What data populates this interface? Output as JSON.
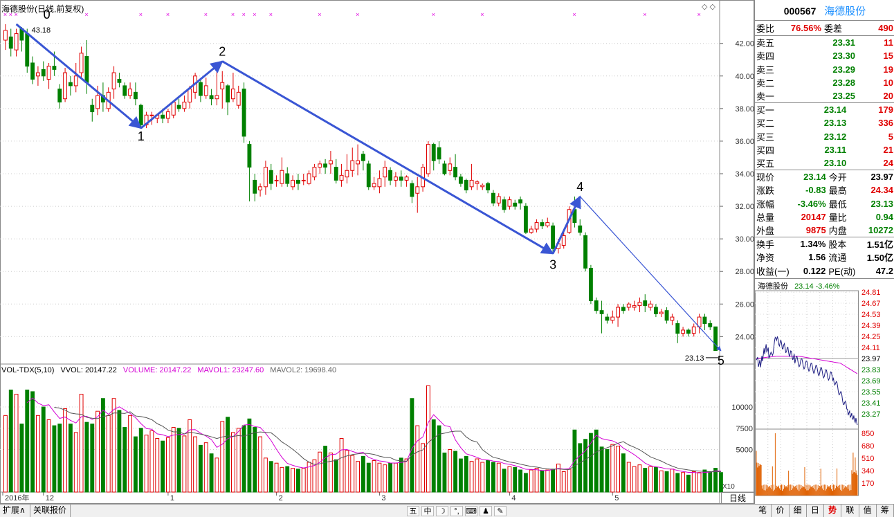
{
  "window": {
    "chart_title": "海德股份(日线,前复权)",
    "daily_tab_label": "日线",
    "x10_label": "X10"
  },
  "volume_header": {
    "indicator": "VOL-TDX(5,10)",
    "vvol": "VVOL: 20147.22",
    "volume": "VOLUME: 20147.22",
    "mavol1": "MAVOL1: 23247.60",
    "mavol2": "MAVOL2: 19698.40"
  },
  "annotations": {
    "wave_labels": [
      "0",
      "1",
      "2",
      "3",
      "4",
      "5"
    ],
    "high_marker": "43.18",
    "low_marker": "23.13"
  },
  "bottom_bar": {
    "expand_label": "扩展∧",
    "related_quote_label": "关联报价",
    "tools": [
      "五",
      "中",
      "☽",
      "°,",
      "⌨",
      "♟",
      "✎"
    ]
  },
  "quote_panel": {
    "code": "000567",
    "name": "海德股份",
    "committee": {
      "ratio_label": "委比",
      "ratio": "76.56%",
      "diff_label": "委差",
      "diff": "490"
    },
    "asks": [
      {
        "label": "卖五",
        "price": "23.31",
        "vol": "11"
      },
      {
        "label": "卖四",
        "price": "23.30",
        "vol": "15"
      },
      {
        "label": "卖三",
        "price": "23.29",
        "vol": "19"
      },
      {
        "label": "卖二",
        "price": "23.28",
        "vol": "10"
      },
      {
        "label": "卖一",
        "price": "23.25",
        "vol": "20"
      }
    ],
    "bids": [
      {
        "label": "买一",
        "price": "23.14",
        "vol": "179"
      },
      {
        "label": "买二",
        "price": "23.13",
        "vol": "336"
      },
      {
        "label": "买三",
        "price": "23.12",
        "vol": "5"
      },
      {
        "label": "买四",
        "price": "23.11",
        "vol": "21"
      },
      {
        "label": "买五",
        "price": "23.10",
        "vol": "24"
      }
    ],
    "stats": [
      {
        "l1": "现价",
        "v1": "23.14",
        "c1": "green",
        "l2": "今开",
        "v2": "23.97",
        "c2": "blk"
      },
      {
        "l1": "涨跌",
        "v1": "-0.83",
        "c1": "green",
        "l2": "最高",
        "v2": "24.34",
        "c2": "red"
      },
      {
        "l1": "涨幅",
        "v1": "-3.46%",
        "c1": "green",
        "l2": "最低",
        "v2": "23.13",
        "c2": "green"
      },
      {
        "l1": "总量",
        "v1": "20147",
        "c1": "red",
        "l2": "量比",
        "v2": "0.94",
        "c2": "green"
      },
      {
        "l1": "外盘",
        "v1": "9875",
        "c1": "red",
        "l2": "内盘",
        "v2": "10272",
        "c2": "green"
      }
    ],
    "fundamentals": [
      {
        "l1": "换手",
        "v1": "1.34%",
        "l2": "股本",
        "v2": "1.51亿"
      },
      {
        "l1": "净资",
        "v1": "1.56",
        "l2": "流通",
        "v2": "1.50亿"
      },
      {
        "l1": "收益(一)",
        "v1": "0.122",
        "l2": "PE(动)",
        "v2": "47.2"
      }
    ]
  },
  "intraday": {
    "name": "海德股份",
    "price_change": "23.14 -3.46%",
    "price_ticks": [
      "24.81",
      "24.67",
      "24.53",
      "24.39",
      "24.25",
      "24.11",
      "23.97",
      "23.83",
      "23.69",
      "23.55",
      "23.41",
      "23.27"
    ],
    "volume_ticks": [
      "850",
      "680",
      "510",
      "340",
      "170"
    ],
    "price_range": [
      23.13,
      24.81
    ],
    "prev_close": 23.97
  },
  "right_tabs": [
    "笔",
    "价",
    "细",
    "日",
    "势",
    "联",
    "值",
    "筹"
  ],
  "right_tab_active": "势",
  "chart_data": {
    "type": "candlestick",
    "title": "海德股份(日线,前复权)",
    "price_axis": {
      "ticks": [
        24,
        26,
        28,
        30,
        32,
        34,
        36,
        38,
        40,
        42
      ],
      "ylim": [
        22.4,
        43.9
      ]
    },
    "volume_axis": {
      "ticks": [
        5000,
        7500,
        10000
      ],
      "ylim": [
        0,
        13500
      ]
    },
    "date_labels": [
      {
        "label": "2016年",
        "index": 0
      },
      {
        "label": "12",
        "index": 7
      },
      {
        "label": "1",
        "index": 30
      },
      {
        "label": "2",
        "index": 50
      },
      {
        "label": "3",
        "index": 69
      },
      {
        "label": "4",
        "index": 93
      },
      {
        "label": "5",
        "index": 112
      }
    ],
    "candles": [
      [
        42.2,
        42.8,
        41.6,
        43.18
      ],
      [
        42.4,
        41.7,
        41.2,
        42.9
      ],
      [
        41.6,
        42.6,
        41.2,
        42.9
      ],
      [
        42.9,
        42.2,
        41.5,
        43.0
      ],
      [
        42.6,
        40.6,
        40.2,
        42.9
      ],
      [
        40.8,
        39.8,
        39.5,
        41.2
      ],
      [
        40.0,
        40.2,
        39.4,
        40.6
      ],
      [
        40.4,
        40.0,
        39.7,
        40.9
      ],
      [
        39.8,
        40.6,
        39.2,
        40.8
      ],
      [
        40.6,
        40.4,
        40.0,
        41.5
      ],
      [
        39.2,
        38.4,
        38.0,
        39.5
      ],
      [
        38.6,
        40.2,
        38.4,
        40.5
      ],
      [
        39.6,
        39.4,
        38.8,
        40.0
      ],
      [
        39.4,
        40.0,
        39.0,
        40.8
      ],
      [
        40.2,
        41.4,
        39.8,
        41.8
      ],
      [
        41.2,
        39.6,
        38.9,
        42.2
      ],
      [
        38.2,
        37.8,
        37.2,
        38.6
      ],
      [
        38.0,
        38.8,
        37.6,
        39.4
      ],
      [
        38.8,
        38.4,
        37.8,
        39.6
      ],
      [
        38.0,
        39.0,
        37.8,
        39.3
      ],
      [
        39.2,
        40.2,
        38.6,
        40.6
      ],
      [
        39.8,
        39.6,
        39.3,
        40.2
      ],
      [
        39.4,
        38.8,
        38.6,
        39.6
      ],
      [
        38.8,
        39.2,
        38.6,
        39.6
      ],
      [
        39.0,
        38.6,
        38.2,
        39.6
      ],
      [
        38.2,
        37.0,
        36.8,
        38.3
      ],
      [
        37.0,
        37.6,
        36.8,
        37.8
      ],
      [
        37.6,
        37.6,
        37.0,
        37.8
      ],
      [
        37.4,
        37.6,
        37.1,
        37.7
      ],
      [
        37.6,
        37.4,
        37.1,
        38.0
      ],
      [
        37.4,
        37.8,
        37.1,
        38.0
      ],
      [
        37.6,
        38.4,
        37.4,
        38.4
      ],
      [
        38.2,
        38.0,
        37.8,
        38.6
      ],
      [
        38.0,
        38.4,
        37.8,
        38.8
      ],
      [
        38.4,
        39.2,
        38.0,
        39.4
      ],
      [
        39.0,
        40.0,
        38.6,
        40.2
      ],
      [
        39.6,
        38.8,
        38.4,
        39.8
      ],
      [
        38.8,
        39.4,
        38.6,
        39.9
      ],
      [
        38.8,
        38.6,
        38.2,
        39.2
      ],
      [
        38.6,
        38.8,
        38.2,
        40.5
      ],
      [
        39.2,
        39.6,
        38.0,
        40.3
      ],
      [
        39.4,
        38.4,
        37.6,
        39.5
      ],
      [
        38.6,
        39.2,
        38.4,
        40.2
      ],
      [
        38.2,
        39.0,
        38.0,
        39.4
      ],
      [
        39.2,
        36.3,
        35.9,
        39.6
      ],
      [
        35.8,
        34.4,
        32.3,
        36.0
      ],
      [
        33.6,
        32.8,
        32.3,
        34.0
      ],
      [
        33.0,
        33.2,
        32.6,
        33.4
      ],
      [
        33.2,
        34.4,
        32.7,
        34.8
      ],
      [
        34.2,
        33.4,
        33.0,
        34.6
      ],
      [
        33.6,
        33.6,
        33.2,
        33.9
      ],
      [
        33.4,
        34.2,
        33.2,
        35.0
      ],
      [
        34.0,
        33.4,
        33.2,
        34.4
      ],
      [
        33.2,
        33.6,
        33.0,
        33.9
      ],
      [
        33.6,
        33.4,
        33.0,
        34.0
      ],
      [
        33.6,
        33.6,
        33.3,
        34.0
      ],
      [
        33.4,
        34.0,
        33.3,
        34.2
      ],
      [
        33.8,
        34.4,
        33.6,
        34.6
      ],
      [
        34.4,
        34.6,
        34.0,
        34.8
      ],
      [
        34.6,
        34.4,
        34.0,
        34.9
      ],
      [
        34.6,
        34.8,
        34.0,
        35.4
      ],
      [
        34.4,
        33.6,
        33.4,
        34.9
      ],
      [
        33.6,
        33.9,
        33.2,
        34.6
      ],
      [
        33.8,
        34.2,
        33.4,
        35.2
      ],
      [
        34.2,
        34.8,
        33.8,
        35.6
      ],
      [
        34.6,
        34.8,
        33.9,
        35.8
      ],
      [
        35.2,
        34.8,
        34.2,
        35.4
      ],
      [
        34.6,
        33.2,
        33.0,
        34.8
      ],
      [
        33.2,
        33.4,
        33.0,
        33.8
      ],
      [
        33.2,
        33.7,
        32.8,
        34.2
      ],
      [
        33.8,
        34.4,
        33.2,
        34.8
      ],
      [
        34.2,
        33.6,
        33.3,
        34.4
      ],
      [
        33.6,
        33.8,
        33.2,
        34.1
      ],
      [
        33.8,
        33.6,
        33.2,
        34.2
      ],
      [
        33.6,
        33.8,
        33.2,
        33.9
      ],
      [
        33.4,
        32.6,
        32.2,
        33.6
      ],
      [
        32.8,
        33.2,
        31.6,
        33.8
      ],
      [
        33.2,
        34.4,
        32.9,
        34.6
      ],
      [
        34.0,
        35.8,
        33.8,
        36.0
      ],
      [
        35.8,
        34.8,
        34.2,
        35.9
      ],
      [
        35.6,
        34.9,
        34.6,
        36.0
      ],
      [
        34.6,
        34.0,
        33.9,
        34.8
      ],
      [
        34.2,
        34.6,
        33.9,
        35.0
      ],
      [
        34.4,
        33.8,
        33.6,
        35.2
      ],
      [
        33.8,
        33.4,
        33.2,
        34.0
      ],
      [
        33.6,
        33.0,
        32.8,
        33.7
      ],
      [
        33.2,
        33.6,
        33.0,
        34.6
      ],
      [
        33.4,
        33.5,
        33.0,
        33.6
      ],
      [
        33.2,
        33.3,
        33.0,
        33.4
      ],
      [
        33.4,
        33.0,
        32.8,
        33.5
      ],
      [
        32.8,
        32.2,
        32.0,
        33.0
      ],
      [
        32.2,
        32.6,
        32.0,
        32.8
      ],
      [
        32.4,
        31.8,
        31.6,
        32.6
      ],
      [
        32.0,
        32.4,
        31.8,
        32.6
      ],
      [
        32.2,
        32.0,
        31.8,
        32.4
      ],
      [
        32.4,
        32.2,
        31.8,
        32.6
      ],
      [
        32.0,
        30.4,
        30.3,
        32.2
      ],
      [
        30.4,
        30.6,
        30.3,
        30.8
      ],
      [
        30.6,
        31.0,
        30.4,
        31.2
      ],
      [
        31.0,
        30.8,
        30.6,
        31.2
      ],
      [
        30.8,
        31.0,
        30.7,
        31.3
      ],
      [
        30.8,
        29.4,
        29.1,
        31.0
      ],
      [
        29.4,
        29.7,
        29.1,
        30.0
      ],
      [
        29.6,
        30.2,
        29.4,
        30.6
      ],
      [
        30.4,
        31.8,
        30.3,
        32.0
      ],
      [
        31.8,
        31.0,
        30.7,
        32.6
      ],
      [
        30.8,
        30.4,
        30.2,
        31.2
      ],
      [
        30.2,
        28.2,
        28.0,
        30.4
      ],
      [
        28.2,
        26.2,
        26.0,
        28.4
      ],
      [
        26.2,
        25.6,
        25.4,
        26.4
      ],
      [
        25.6,
        25.4,
        24.2,
        26.2
      ],
      [
        25.2,
        25.0,
        24.8,
        25.4
      ],
      [
        25.0,
        25.2,
        24.8,
        25.6
      ],
      [
        25.2,
        25.8,
        24.6,
        26.0
      ],
      [
        25.8,
        25.6,
        25.4,
        26.0
      ],
      [
        25.8,
        26.0,
        25.6,
        26.1
      ],
      [
        25.8,
        25.9,
        25.6,
        26.2
      ],
      [
        25.9,
        26.1,
        25.5,
        26.4
      ],
      [
        26.2,
        25.9,
        25.5,
        26.6
      ],
      [
        25.8,
        26.0,
        25.6,
        26.2
      ],
      [
        25.8,
        25.4,
        25.2,
        26.0
      ],
      [
        25.4,
        25.5,
        25.2,
        25.7
      ],
      [
        25.6,
        25.0,
        24.8,
        25.8
      ],
      [
        25.0,
        25.2,
        24.7,
        25.4
      ],
      [
        24.8,
        24.2,
        23.6,
        25.0
      ],
      [
        24.2,
        24.4,
        24.0,
        24.6
      ],
      [
        24.4,
        24.2,
        24.0,
        24.5
      ],
      [
        24.2,
        24.6,
        24.0,
        24.8
      ],
      [
        24.6,
        25.2,
        24.2,
        25.4
      ],
      [
        25.2,
        24.8,
        24.4,
        25.4
      ],
      [
        24.8,
        24.6,
        24.4,
        25.0
      ],
      [
        24.6,
        23.14,
        23.13,
        24.34
      ]
    ],
    "volumes": [
      9000,
      12000,
      11500,
      8000,
      12000,
      11800,
      9000,
      10000,
      8500,
      7800,
      8000,
      9800,
      8000,
      7000,
      11500,
      8200,
      8000,
      9500,
      11000,
      9000,
      11000,
      9600,
      7600,
      9000,
      6500,
      7500,
      6700,
      7200,
      6300,
      6000,
      6400,
      7600,
      7500,
      6600,
      8500,
      6500,
      5500,
      5800,
      4500,
      4000,
      8300,
      8800,
      7000,
      7500,
      7800,
      8600,
      7600,
      6500,
      4000,
      3600,
      3400,
      2900,
      3000,
      2800,
      2700,
      2800,
      3500,
      3800,
      4700,
      5400,
      4600,
      3800,
      6300,
      4900,
      4300,
      3600,
      4200,
      3400,
      3700,
      3400,
      3200,
      3400,
      3400,
      4000,
      3900,
      11000,
      7800,
      5700,
      12500,
      8500,
      7800,
      4600,
      5000,
      4800,
      3900,
      4200,
      3600,
      3900,
      3500,
      3700,
      3500,
      3400,
      2700,
      3000,
      2900,
      2600,
      2200,
      2600,
      2800,
      2500,
      2600,
      2700,
      3300,
      2400,
      2700,
      7300,
      5700,
      6200,
      6900,
      7300,
      5300,
      5000,
      5600,
      5400,
      4500,
      3500,
      3000,
      3200,
      2800,
      3000,
      2900,
      2500,
      2400,
      2700,
      2200,
      2300,
      2000,
      2400,
      2300,
      2600,
      2400,
      2800,
      2300
    ],
    "wave_points": [
      {
        "label": "0",
        "index": 2,
        "price": 43.18
      },
      {
        "label": "1",
        "index": 25,
        "price": 36.8
      },
      {
        "label": "2",
        "index": 40,
        "price": 40.9
      },
      {
        "label": "3",
        "index": 101,
        "price": 29.1
      },
      {
        "label": "4",
        "index": 106,
        "price": 32.6
      },
      {
        "label": "5",
        "index": 132,
        "price": 23.13
      }
    ]
  }
}
